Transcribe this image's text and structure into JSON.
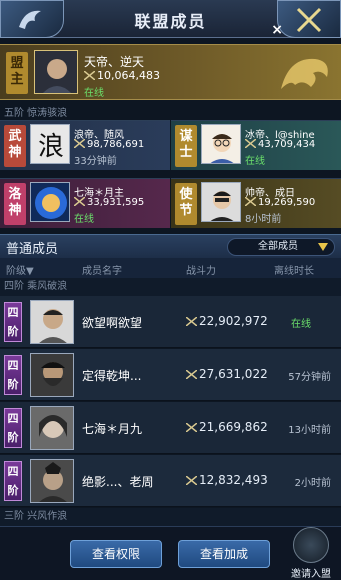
{
  "header": {
    "title": "联盟成员",
    "close": "×"
  },
  "leader": {
    "role": "盟主",
    "name": "天帝、逆天",
    "power": "10,064,483",
    "status": "在线"
  },
  "officer_tier_label": "五阶  惊涛骇浪",
  "officers": [
    {
      "role": "武神",
      "name": "浪帝、随风",
      "power": "98,786,691",
      "status": "33分钟前"
    },
    {
      "role": "谋士",
      "name": "冰帝、l@shine",
      "power": "43,709,434",
      "status": "在线"
    },
    {
      "role": "洛神",
      "name": "七海＊月主",
      "power": "33,931,595",
      "status": "在线"
    },
    {
      "role": "使节",
      "name": "帅帝、成日",
      "power": "19,269,590",
      "status": "8小时前"
    }
  ],
  "members": {
    "title": "普通成员",
    "filter": "全部成员",
    "columns": {
      "rank": "阶级▼",
      "name": "成员名字",
      "power": "战斗力",
      "offline": "离线时长"
    },
    "tier4_label": "四阶  乘风破浪",
    "tier3_label": "三阶  兴风作浪",
    "rows": [
      {
        "rank": "四阶",
        "name": "欲望啊欲望",
        "power": "22,902,972",
        "status": "在线"
      },
      {
        "rank": "四阶",
        "name": "定得乾坤...",
        "power": "27,631,022",
        "status": "57分钟前"
      },
      {
        "rank": "四阶",
        "name": "七海＊月九",
        "power": "21,669,862",
        "status": "13小时前"
      },
      {
        "rank": "四阶",
        "name": "绝影...、老周",
        "power": "12,832,493",
        "status": "2小时前"
      }
    ]
  },
  "footer": {
    "view_permissions": "查看权限",
    "view_join": "查看加成",
    "invite": "邀请入盟"
  }
}
